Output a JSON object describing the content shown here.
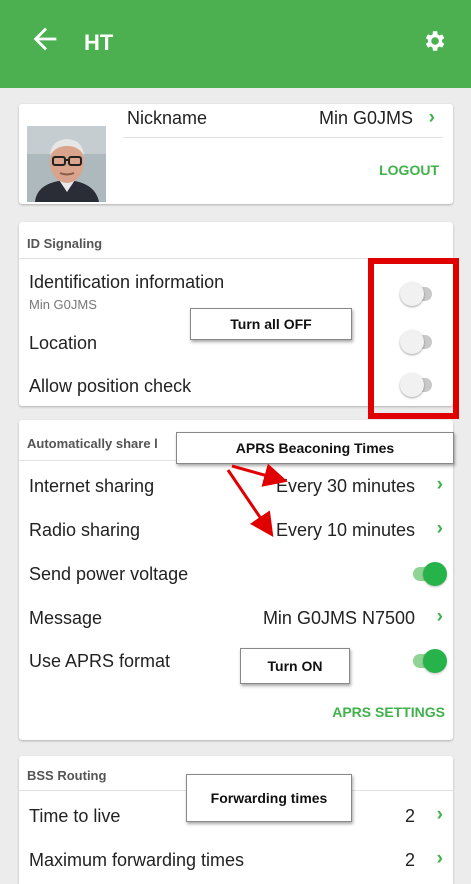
{
  "appbar": {
    "title": "HT"
  },
  "profile": {
    "nickname_label": "Nickname",
    "nickname_value": "Min G0JMS",
    "logout_label": "LOGOUT"
  },
  "id_signaling": {
    "header": "ID Signaling",
    "identification_label": "Identification information",
    "identification_sub": "Min G0JMS",
    "location_label": "Location",
    "position_check_label": "Allow position check"
  },
  "auto_share": {
    "header": "Automatically share l",
    "internet_label": "Internet sharing",
    "internet_value": "Every 30 minutes",
    "radio_label": "Radio sharing",
    "radio_value": "Every 10 minutes",
    "power_label": "Send power voltage",
    "message_label": "Message",
    "message_value": "Min G0JMS N7500",
    "aprs_format_label": "Use APRS format",
    "aprs_settings_label": "APRS SETTINGS"
  },
  "bss": {
    "header": "BSS Routing",
    "ttl_label": "Time to live",
    "ttl_value": "2",
    "max_fwd_label": "Maximum forwarding times",
    "max_fwd_value": "2"
  },
  "annotations": {
    "turn_all_off": "Turn all OFF",
    "aprs_times": "APRS Beaconing Times",
    "turn_on": "Turn ON",
    "forwarding_times": "Forwarding times"
  },
  "switches": {
    "identification": false,
    "location": false,
    "position_check": false,
    "power_voltage": true,
    "aprs_format": true
  },
  "colors": {
    "appbar": "#4caf50",
    "accent_green": "#3fb24a",
    "annotation_red": "#e00000"
  },
  "icons": {
    "back": "arrow-left-icon",
    "settings": "gear-icon",
    "chevron": "chevron-right-icon"
  }
}
